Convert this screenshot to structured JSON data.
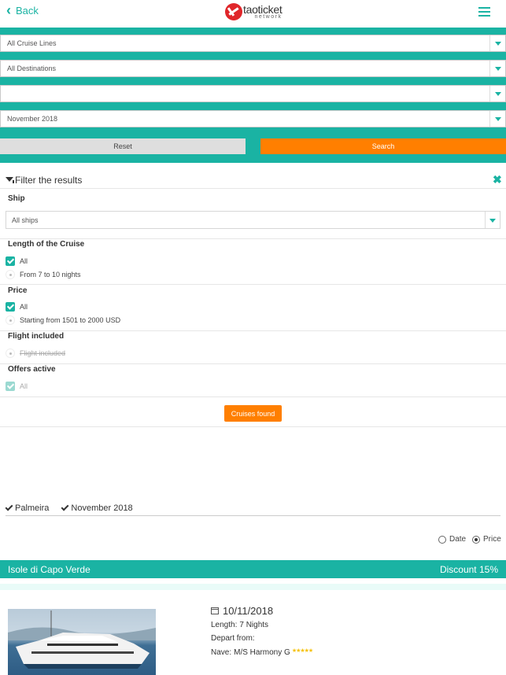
{
  "header": {
    "back_label": "Back",
    "logo_name": "taoticket",
    "logo_sub": "network"
  },
  "search": {
    "cruise_lines": "All Cruise Lines",
    "destinations": "All Destinations",
    "port": "",
    "month": "November 2018",
    "reset_label": "Reset",
    "search_label": "Search"
  },
  "filter": {
    "title": "Filter the results",
    "ship": {
      "label": "Ship",
      "selected": "All ships"
    },
    "length": {
      "label": "Length of the Cruise",
      "options": [
        "All",
        "From 7 to 10 nights"
      ]
    },
    "price": {
      "label": "Price",
      "options": [
        "All",
        "Starting from 1501 to 2000 USD"
      ]
    },
    "flight": {
      "label": "Flight included",
      "options": [
        "Flight included"
      ]
    },
    "offers": {
      "label": "Offers active",
      "options": [
        "All"
      ]
    },
    "cruises_found_label": "Cruises found"
  },
  "active_filters": [
    "Palmeira",
    "November 2018"
  ],
  "sort": {
    "date_label": "Date",
    "price_label": "Price",
    "selected": "Price"
  },
  "result": {
    "title": "Isole di Capo Verde",
    "discount": "Discount 15%",
    "date": "10/11/2018",
    "length_key": "Length:",
    "length_val": "7 Nights",
    "depart_key": "Depart from:",
    "depart_val": "",
    "ship_key": "Nave:",
    "ship_val": "M/S Harmony G",
    "stars": "★★★★★"
  },
  "colors": {
    "teal": "#1ab3a3",
    "orange": "#ff7f00",
    "star": "#f5c000"
  }
}
